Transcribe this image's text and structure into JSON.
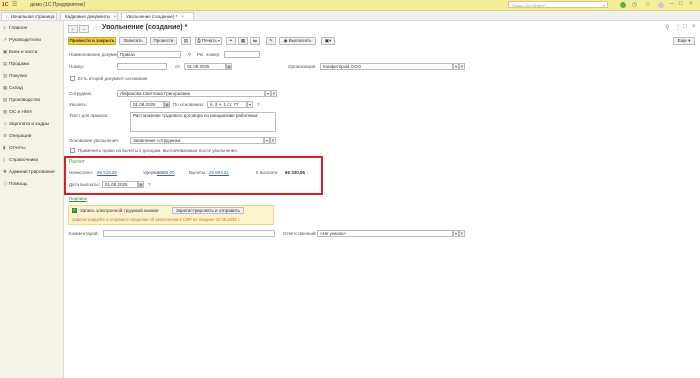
{
  "app": {
    "logo": "1С",
    "title": "демо  (1С:Предприятие)",
    "search_placeholder": "Поиск Ctrl+Shift+F"
  },
  "tabs": [
    {
      "label": "Начальная страница"
    },
    {
      "label": "Кадровые документы"
    },
    {
      "label": "Увольнение (создание) *"
    }
  ],
  "sidebar": {
    "items": [
      {
        "label": "Главное",
        "icon": "menu-icon"
      },
      {
        "label": "Руководителю",
        "icon": "chart-icon"
      },
      {
        "label": "Банк и касса",
        "icon": "bank-icon"
      },
      {
        "label": "Продажи",
        "icon": "cart-icon"
      },
      {
        "label": "Покупки",
        "icon": "basket-icon"
      },
      {
        "label": "Склад",
        "icon": "warehouse-icon"
      },
      {
        "label": "Производство",
        "icon": "factory-icon"
      },
      {
        "label": "ОС и НМА",
        "icon": "assets-icon"
      },
      {
        "label": "Зарплата и кадры",
        "icon": "people-icon"
      },
      {
        "label": "Операции",
        "icon": "operations-icon"
      },
      {
        "label": "Отчеты",
        "icon": "reports-icon"
      },
      {
        "label": "Справочники",
        "icon": "book-icon"
      },
      {
        "label": "Администрирование",
        "icon": "gear-icon"
      },
      {
        "label": "Помощь",
        "icon": "help-icon"
      }
    ]
  },
  "doc": {
    "title": "Увольнение (создание) *",
    "toolbar": {
      "post_close": "Провести и закрыть",
      "save": "Записать",
      "post": "Провести",
      "print": "Печать",
      "pay": "Выплатить",
      "more": "Еще"
    },
    "form": {
      "doc_name_label": "Наименование документа:",
      "doc_name_value": "Приказ",
      "reg_label": "Рег. номер:",
      "reg_value": "",
      "number_label": "Номер:",
      "number_value": "",
      "date_from_label": "от:",
      "date_value": "01.08.2025",
      "org_label": "Организация:",
      "org_value": "Конфетпром ООО",
      "second_basis_label": "Есть второй документ-основание",
      "employee_label": "Сотрудник:",
      "employee_value": "Лифанова Светлана Григорьевна",
      "dismiss_label": "Уволить:",
      "dismiss_date": "01.08.2025",
      "basis_label": "По основанию:",
      "basis_value": "п. 3 ч. 1 ст. 77",
      "order_text_label": "Текст для приказа:",
      "order_text_value": "Расторжение трудового договора по инициативе работника",
      "reason_label": "Основание увольнения:",
      "reason_value": "Заявление сотрудника",
      "apply_right_label": "Применить право на вычеты к доходам, выплачиваемым после увольнения"
    },
    "calc": {
      "title": "Расчет",
      "accrued_label": "Начислено:",
      "accrued_value": "68 518,65",
      "withheld_label": "Удержано:",
      "withheld_value": "2 188,00",
      "deductions_label": "Вычеты:",
      "deductions_value": "25 894,61",
      "topay_label": "К выплате:",
      "topay_value": "66 330,55",
      "paydate_label": "Дата выплаты:",
      "paydate_value": "01.08.2025",
      "help": "?"
    },
    "sign_link": "Подписи",
    "etk": {
      "checkbox_label": "Запись электронной трудовой книжки",
      "register_btn": "Зарегистрировать и отправить",
      "note": "Зарегистрируйте и отправьте сведения об увольнении в СФР не позднее 04.08.2025 г."
    },
    "footer": {
      "comment_label": "Комментарий:",
      "comment_value": "",
      "resp_label": "Ответственный:",
      "resp_value": "<Не указан>"
    }
  },
  "colors": {
    "topbar": "#f4ed9c",
    "accent_yellow": "#f5d13b",
    "link": "#3a63b5",
    "highlight": "#e11e1e",
    "green": "#4b9b43"
  }
}
